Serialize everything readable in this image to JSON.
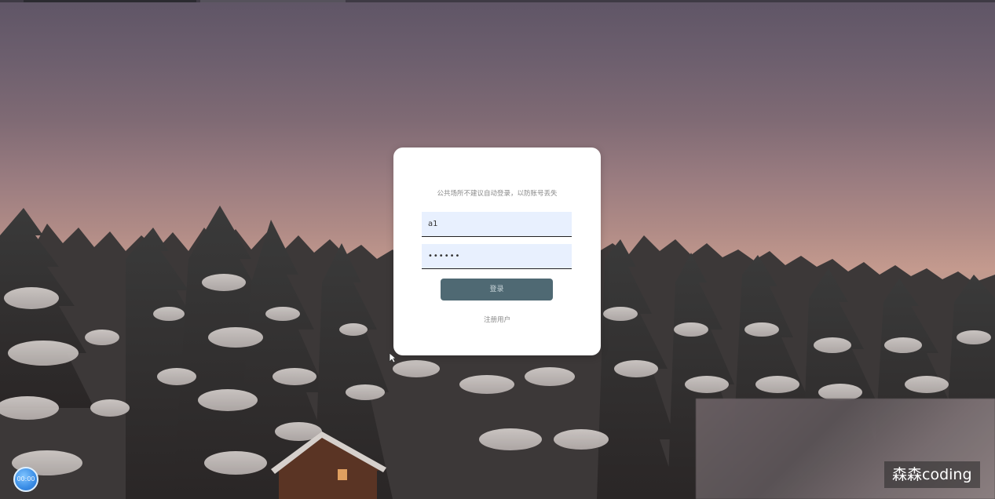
{
  "login": {
    "notice": "公共场所不建议自动登录，以防账号丢失",
    "username_value": "a1",
    "password_value": "••••••",
    "login_button": "登录",
    "register_link": "注册用户"
  },
  "overlay": {
    "timer_text": "00:00",
    "watermark": "森森coding"
  },
  "colors": {
    "login_button_bg": "#4f6973",
    "input_bg": "#e8f0fe",
    "card_bg": "#ffffff"
  },
  "icons": {
    "cursor": "mouse-cursor-icon"
  }
}
